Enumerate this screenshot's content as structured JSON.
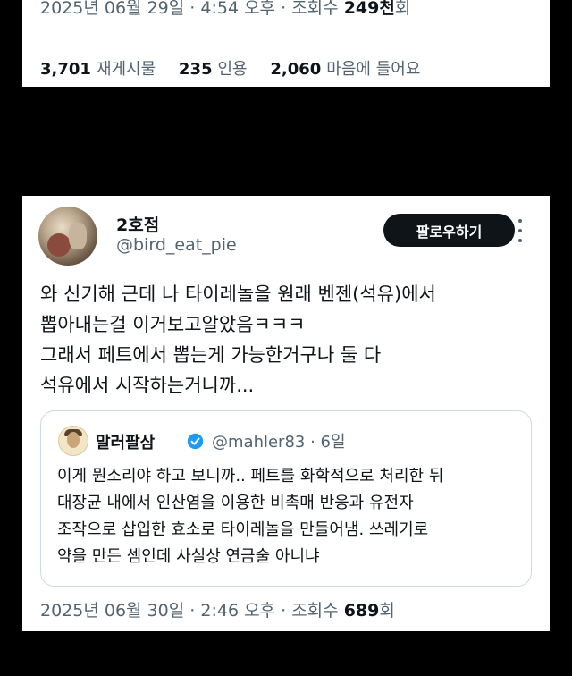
{
  "top_tweet": {
    "date": "2025년 06월 29일",
    "sep": "·",
    "time": "4:54 오후",
    "views_prefix": "조회수",
    "views_num": "249천",
    "views_suffix": "회",
    "stats": [
      {
        "num": "3,701",
        "label": "재게시물"
      },
      {
        "num": "235",
        "label": "인용"
      },
      {
        "num": "2,060",
        "label": "마음에 들어요"
      }
    ]
  },
  "tweet": {
    "name": "2호점",
    "handle": "@bird_eat_pie",
    "follow_label": "팔로우하기",
    "lines": [
      "와 신기해 근데 나 타이레놀을 원래 벤젠(석유)에서",
      "뽑아내는걸 이거보고알았음ㅋㅋㅋ",
      "그래서 페트에서 뽑는게 가능한거구나 둘 다",
      "석유에서 시작하는거니까..."
    ],
    "quote": {
      "name": "말러팔삼",
      "handle": "@mahler83",
      "time": "· 6일",
      "lines": [
        "이게 뭔소리야 하고 보니까.. 페트를 화학적으로 처리한 뒤",
        "대장균 내에서 인산염을 이용한 비촉매 반응과 유전자",
        "조작으로 삽입한 효소로 타이레놀을 만들어냄. 쓰레기로",
        "약을 만든 셈인데 사실상 연금술 아니냐"
      ]
    },
    "date": "2025년 06월 30일",
    "sep": "·",
    "time": "2:46 오후",
    "views_prefix": "조회수",
    "views_num": "689",
    "views_suffix": "회",
    "colors": {
      "verified": "#1d9bf0",
      "button": "#0f1419",
      "muted": "#536471"
    }
  }
}
